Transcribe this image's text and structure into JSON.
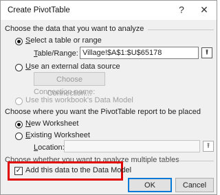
{
  "dialog": {
    "title": "Create PivotTable",
    "help_label": "?",
    "close_label": "✕"
  },
  "source_section": {
    "heading": "Choose the data that you want to analyze",
    "select_range": {
      "label": "Select a table or range",
      "mnemonic": "S",
      "rest": "elect a table or range",
      "checked": true
    },
    "table_range": {
      "label_mnemonic": "T",
      "label_rest": "able/Range:",
      "value": "Village!$A$1:$U$65178"
    },
    "external_source": {
      "mnemonic": "U",
      "rest": "se an external data source",
      "checked": false
    },
    "choose_connection_button": "Choose Connection...",
    "connection_name_label": "Connection name:",
    "data_model_source": {
      "label": "Use this workbook's Data Model",
      "checked": false,
      "disabled": true
    }
  },
  "placement_section": {
    "heading": "Choose where you want the PivotTable report to be placed",
    "new_worksheet": {
      "mnemonic": "N",
      "rest": "ew Worksheet",
      "checked": true
    },
    "existing_worksheet": {
      "mnemonic": "E",
      "rest": "xisting Worksheet",
      "checked": false
    },
    "location": {
      "mnemonic": "L",
      "rest": "ocation:",
      "value": ""
    }
  },
  "multi_section": {
    "heading": "Choose whether you want to analyze multiple tables",
    "add_to_data_model": {
      "label": "Add this data to the Data Model",
      "mnemonic": "M",
      "checked": true
    }
  },
  "buttons": {
    "ok": "OK",
    "cancel": "Cancel"
  },
  "icons": {
    "range_picker": "range-picker-icon"
  },
  "colors": {
    "highlight": "#e00000",
    "default_button_border": "#0078d7"
  }
}
